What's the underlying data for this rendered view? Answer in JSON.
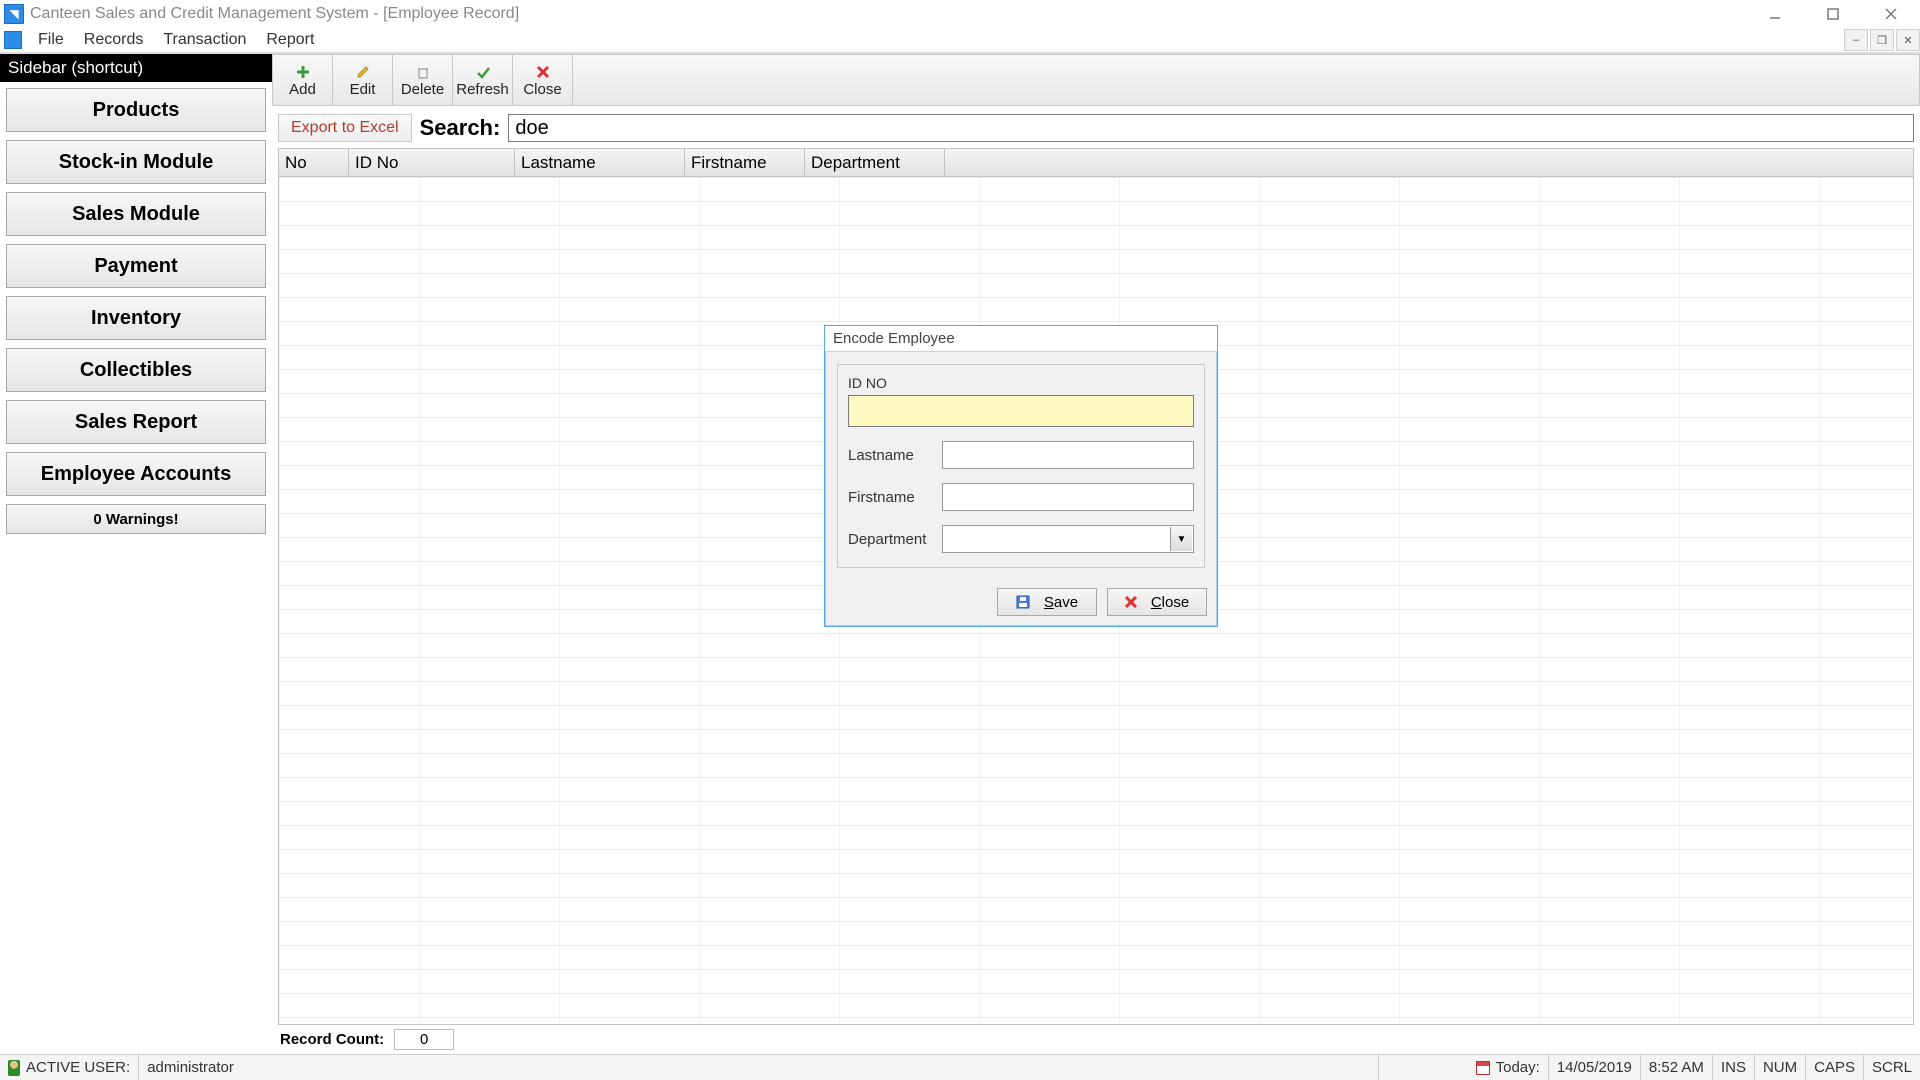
{
  "titlebar": {
    "title": "Canteen Sales and Credit Management System - [Employee Record]"
  },
  "menubar": {
    "items": [
      "File",
      "Records",
      "Transaction",
      "Report"
    ]
  },
  "sidebar": {
    "header": "Sidebar (shortcut)",
    "items": [
      "Products",
      "Stock-in Module",
      "Sales Module",
      "Payment",
      "Inventory",
      "Collectibles",
      "Sales Report",
      "Employee Accounts"
    ],
    "warnings": "0 Warnings!"
  },
  "toolbar": {
    "add": "Add",
    "edit": "Edit",
    "delete": "Delete",
    "refresh": "Refresh",
    "close": "Close"
  },
  "search": {
    "export": "Export to Excel",
    "label": "Search:",
    "value": "doe"
  },
  "grid": {
    "columns": {
      "no": "No",
      "id": "ID No",
      "lastname": "Lastname",
      "firstname": "Firstname",
      "department": "Department"
    }
  },
  "record_count": {
    "label": "Record Count:",
    "value": "0"
  },
  "dialog": {
    "title": "Encode Employee",
    "idno_label": "ID NO",
    "lastname_label": "Lastname",
    "firstname_label": "Firstname",
    "department_label": "Department",
    "save": "Save",
    "close": "Close"
  },
  "status": {
    "active_user_label": "ACTIVE USER:",
    "active_user": "administrator",
    "today_label": "Today:",
    "date": "14/05/2019",
    "time": "8:52 AM",
    "ins": "INS",
    "num": "NUM",
    "caps": "CAPS",
    "scrl": "SCRL"
  }
}
